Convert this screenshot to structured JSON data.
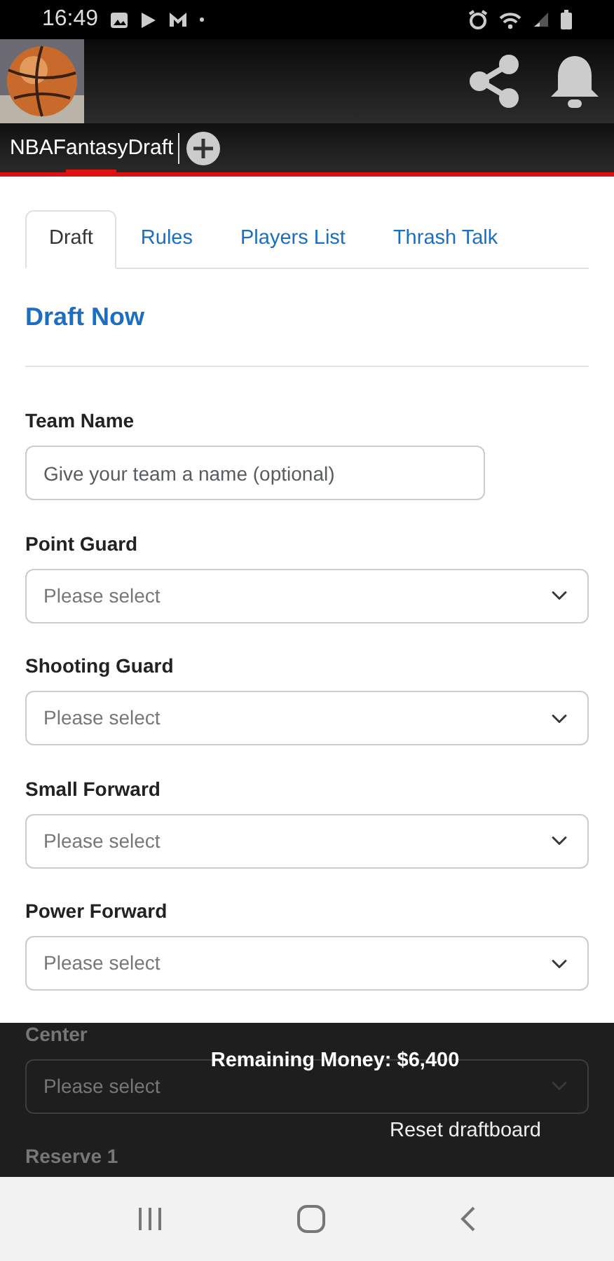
{
  "status_bar": {
    "time": "16:49"
  },
  "app_tabs": [
    {
      "label": "NBAFantasyDraft",
      "selected": true
    }
  ],
  "page_tabs": [
    {
      "label": "Draft",
      "selected": true
    },
    {
      "label": "Rules",
      "selected": false
    },
    {
      "label": "Players List",
      "selected": false
    },
    {
      "label": "Thrash Talk",
      "selected": false
    }
  ],
  "heading": "Draft Now",
  "fields": [
    {
      "kind": "text",
      "label": "Team Name",
      "placeholder": "Give your team a name (optional)"
    },
    {
      "kind": "select",
      "label": "Point Guard",
      "value": "Please select"
    },
    {
      "kind": "select",
      "label": "Shooting Guard",
      "value": "Please select"
    },
    {
      "kind": "select",
      "label": "Small Forward",
      "value": "Please select"
    },
    {
      "kind": "select",
      "label": "Power Forward",
      "value": "Please select"
    },
    {
      "kind": "select",
      "label": "Center",
      "value": "Please select"
    },
    {
      "kind": "label",
      "label": "Reserve 1"
    }
  ],
  "footer": {
    "remaining": "Remaining Money: $6,400",
    "reset": "Reset draftboard"
  }
}
